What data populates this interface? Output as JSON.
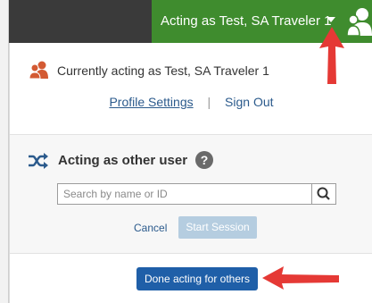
{
  "header": {
    "acting_label": "Acting as Test, SA Traveler 1",
    "accent_color": "#3f8c2e",
    "dropdown_icon": "caret-down-icon",
    "user_icon": "users-icon"
  },
  "panel": {
    "current_text": "Currently acting as Test, SA Traveler 1",
    "current_icon": "users-icon",
    "profile_settings": "Profile Settings",
    "separator": "|",
    "sign_out": "Sign Out"
  },
  "acting_other": {
    "title": "Acting as other user",
    "shuffle_icon": "shuffle-icon",
    "help_icon_label": "?",
    "search_placeholder": "Search by name or ID",
    "search_value": "",
    "cancel": "Cancel",
    "start_session": "Start Session"
  },
  "done_button": "Done acting for others",
  "annotations": {
    "arrow_color": "#e53935"
  }
}
